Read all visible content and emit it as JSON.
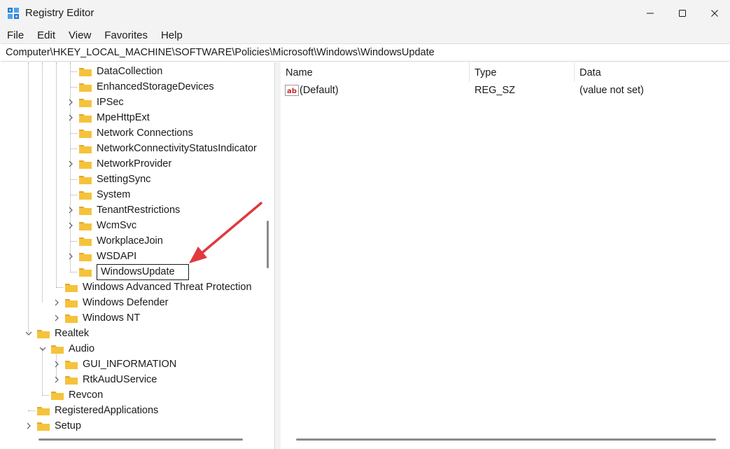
{
  "window": {
    "title": "Registry Editor",
    "minimize_icon": "minimize-icon",
    "maximize_icon": "maximize-icon",
    "close_icon": "close-icon"
  },
  "menu": {
    "items": [
      "File",
      "Edit",
      "View",
      "Favorites",
      "Help"
    ]
  },
  "address": {
    "path": "Computer\\HKEY_LOCAL_MACHINE\\SOFTWARE\\Policies\\Microsoft\\Windows\\WindowsUpdate"
  },
  "tree": {
    "rows": [
      {
        "label": "DataCollection",
        "level": 3,
        "expander": "none"
      },
      {
        "label": "EnhancedStorageDevices",
        "level": 3,
        "expander": "none"
      },
      {
        "label": "IPSec",
        "level": 3,
        "expander": "collapsed"
      },
      {
        "label": "MpeHttpExt",
        "level": 3,
        "expander": "collapsed"
      },
      {
        "label": "Network Connections",
        "level": 3,
        "expander": "none"
      },
      {
        "label": "NetworkConnectivityStatusIndicator",
        "level": 3,
        "expander": "none"
      },
      {
        "label": "NetworkProvider",
        "level": 3,
        "expander": "collapsed"
      },
      {
        "label": "SettingSync",
        "level": 3,
        "expander": "none"
      },
      {
        "label": "System",
        "level": 3,
        "expander": "none"
      },
      {
        "label": "TenantRestrictions",
        "level": 3,
        "expander": "collapsed"
      },
      {
        "label": "WcmSvc",
        "level": 3,
        "expander": "collapsed"
      },
      {
        "label": "WorkplaceJoin",
        "level": 3,
        "expander": "none"
      },
      {
        "label": "WSDAPI",
        "level": 3,
        "expander": "collapsed"
      },
      {
        "label": "WindowsUpdate",
        "level": 3,
        "expander": "none",
        "renaming": true
      },
      {
        "label": "Windows Advanced Threat Protection",
        "level": 2,
        "expander": "none"
      },
      {
        "label": "Windows Defender",
        "level": 2,
        "expander": "collapsed"
      },
      {
        "label": "Windows NT",
        "level": 2,
        "expander": "collapsed"
      },
      {
        "label": "Realtek",
        "level": 0,
        "expander": "expanded"
      },
      {
        "label": "Audio",
        "level": 1,
        "expander": "expanded"
      },
      {
        "label": "GUI_INFORMATION",
        "level": 2,
        "expander": "collapsed"
      },
      {
        "label": "RtkAudUService",
        "level": 2,
        "expander": "collapsed"
      },
      {
        "label": "Revcon",
        "level": 1,
        "expander": "none"
      },
      {
        "label": "RegisteredApplications",
        "level": 0,
        "expander": "none"
      },
      {
        "label": "Setup",
        "level": 0,
        "expander": "collapsed"
      }
    ]
  },
  "values": {
    "columns": {
      "name": "Name",
      "type": "Type",
      "data": "Data"
    },
    "rows": [
      {
        "icon": "string-value-icon",
        "name": "(Default)",
        "type": "REG_SZ",
        "data": "(value not set)"
      }
    ]
  },
  "colors": {
    "folder": "#f5c33b",
    "folder_dark": "#e0a82a",
    "annotation_arrow": "#e0393e",
    "chrome": "#f3f3f3"
  }
}
